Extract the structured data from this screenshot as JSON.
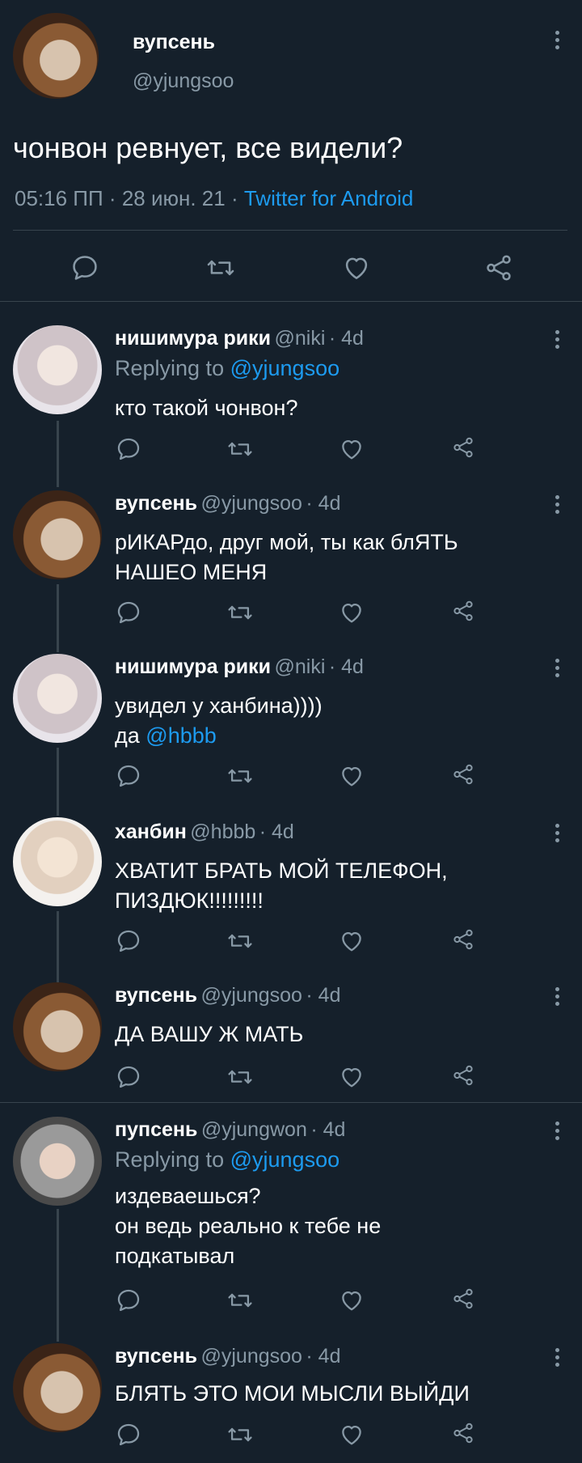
{
  "main_tweet": {
    "name": "вупсень",
    "handle": "@yjungsoo",
    "text": "чонвон ревнует, все видели?",
    "time": "05:16 ПП",
    "date": "28 июн. 21",
    "source": "Twitter for Android",
    "dot": "·"
  },
  "replies": [
    {
      "name": "нишимура рики",
      "handle": "@niki",
      "age": "· 4d",
      "replying_prefix": "Replying to",
      "replying_to": "@yjungsoo",
      "line1": "кто такой чонвон?"
    },
    {
      "name": "вупсень",
      "handle": "@yjungsoo",
      "age": "· 4d",
      "line1": "рИКАРдо, друг мой, ты как блЯТЬ",
      "line2": "НАШЕО МЕНЯ"
    },
    {
      "name": "нишимура рики",
      "handle": "@niki",
      "age": "· 4d",
      "line1": "увидел у ханбина))))",
      "line2_prefix": "да",
      "mention": "@hbbb"
    },
    {
      "name": "ханбин",
      "handle": "@hbbb",
      "age": "· 4d",
      "line1": "ХВАТИТ БРАТЬ МОЙ ТЕЛЕФОН,",
      "line2": "ПИЗДЮК!!!!!!!!!"
    },
    {
      "name": "вупсень",
      "handle": "@yjungsoo",
      "age": "· 4d",
      "line1": "ДА ВАШУ Ж МАТЬ"
    },
    {
      "name": "пупсень",
      "handle": "@yjungwon",
      "age": "· 4d",
      "replying_prefix": "Replying to",
      "replying_to": "@yjungsoo",
      "line1": "издеваешься?",
      "line2": "он ведь реально к тебе не",
      "line3": "подкатывал"
    },
    {
      "name": "вупсень",
      "handle": "@yjungsoo",
      "age": "· 4d",
      "line1": "БЛЯТЬ ЭТО МОИ МЫСЛИ ВЫЙДИ"
    }
  ],
  "icons": {
    "reply": "reply-icon",
    "retweet": "retweet-icon",
    "like": "heart-icon",
    "share": "share-icon",
    "more": "more-icon"
  },
  "colors": {
    "background": "#15202b",
    "text": "#ffffff",
    "muted": "#8899a6",
    "link": "#1d9bf0",
    "divider": "#38444d"
  }
}
